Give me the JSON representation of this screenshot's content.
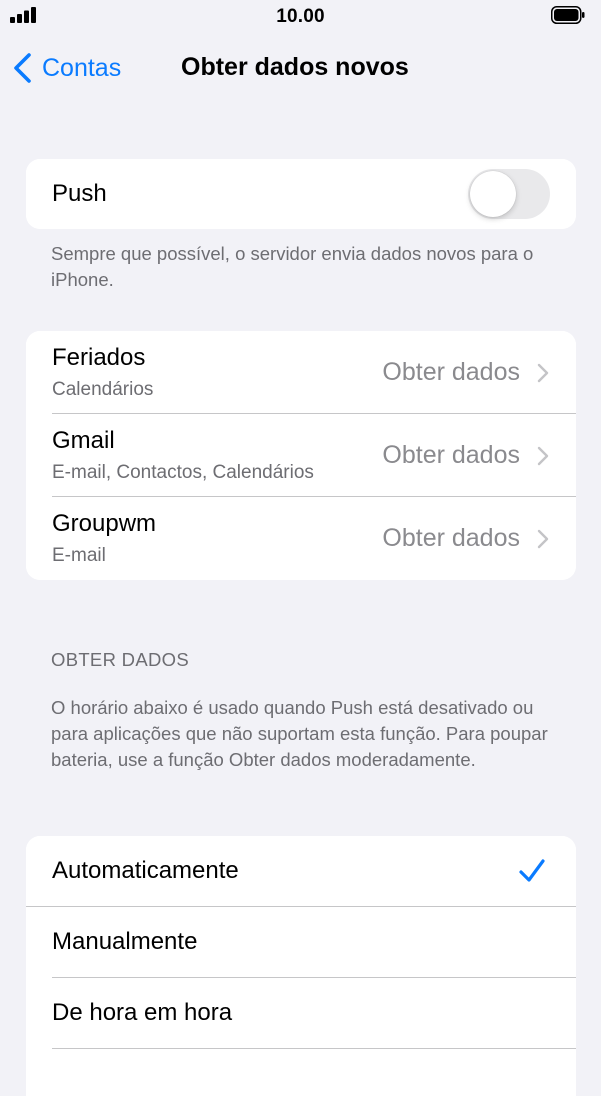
{
  "status": {
    "time": "10.00"
  },
  "nav": {
    "back_label": "Contas",
    "title": "Obter dados novos"
  },
  "push": {
    "label": "Push",
    "enabled": false,
    "footnote": "Sempre que possível, o servidor envia dados novos para o iPhone."
  },
  "accounts": [
    {
      "name": "Feriados",
      "detail": "Calendários",
      "value": "Obter dados"
    },
    {
      "name": "Gmail",
      "detail": "E-mail, Contactos, Calendários",
      "value": "Obter dados"
    },
    {
      "name": "Groupwm",
      "detail": "E-mail",
      "value": "Obter dados"
    }
  ],
  "fetch_section": {
    "header": "OBTER DADOS",
    "description": "O horário abaixo é usado quando Push está desativado ou para aplicações que não suportam esta função. Para poupar bateria, use a função Obter dados moderadamente.",
    "options": [
      {
        "label": "Automaticamente",
        "selected": true
      },
      {
        "label": "Manualmente",
        "selected": false
      },
      {
        "label": "De hora em hora",
        "selected": false
      }
    ]
  },
  "colors": {
    "accent": "#0a7bff",
    "background": "#f2f2f7",
    "secondary_text": "#6d6d72"
  },
  "icons": [
    "signal-icon",
    "battery-icon",
    "back-chevron-icon",
    "chevron-right-icon",
    "checkmark-icon"
  ]
}
